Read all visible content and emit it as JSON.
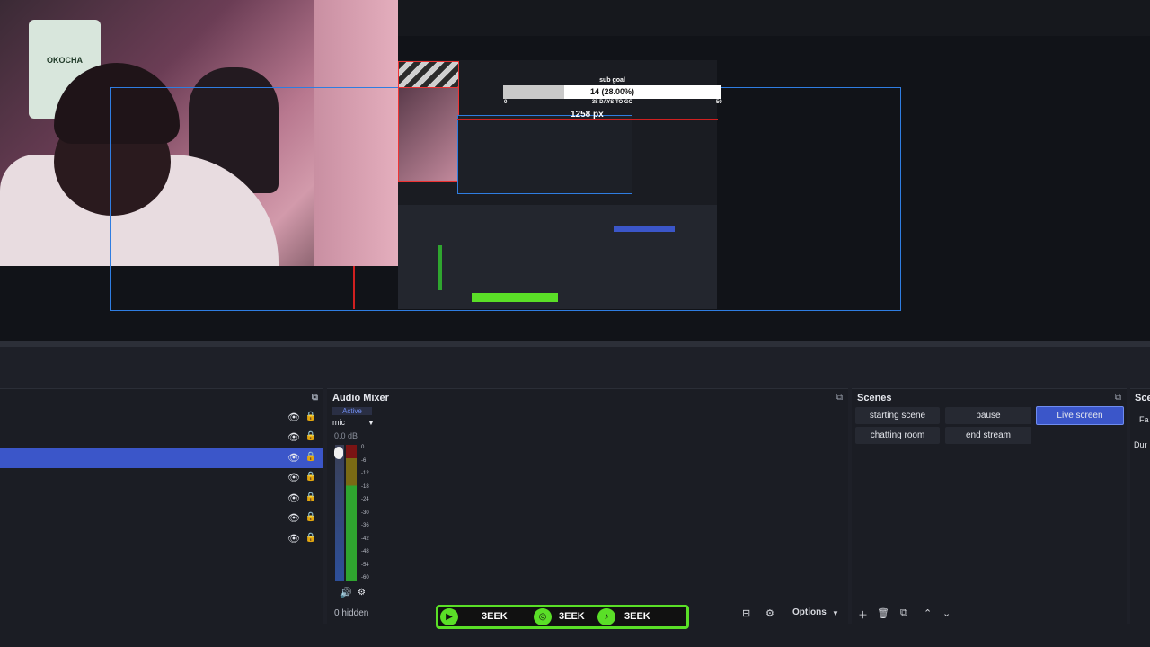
{
  "preview": {
    "sub_goal_title": "sub goal",
    "sub_goal_value": "14 (28.00%)",
    "sub_goal_progress": 0.28,
    "sub_goal_min": "0",
    "sub_goal_max": "50",
    "sub_goal_deadline": "38 DAYS TO GO",
    "measure_label": "1258 px",
    "webcam_jersey_text": "OKOCHA"
  },
  "sources": {
    "float_icon": "popout-icon",
    "rows": [
      {
        "selected": false
      },
      {
        "selected": false
      },
      {
        "selected": true
      },
      {
        "selected": false
      },
      {
        "selected": false
      },
      {
        "selected": false
      },
      {
        "selected": false
      }
    ]
  },
  "mixer": {
    "title": "Audio Mixer",
    "status": "Active",
    "channel": "mic",
    "level": "0.0 dB",
    "ticks": [
      "0",
      "-6",
      "-12",
      "-18",
      "-24",
      "-30",
      "-36",
      "-42",
      "-48",
      "-54",
      "-60"
    ],
    "hidden_label": "0 hidden",
    "options_label": "Options"
  },
  "scenes": {
    "title": "Scenes",
    "items": [
      {
        "label": "starting scene",
        "active": false
      },
      {
        "label": "pause",
        "active": false
      },
      {
        "label": "Live screen",
        "active": true
      },
      {
        "label": "chatting room",
        "active": false
      },
      {
        "label": "end stream",
        "active": false
      }
    ]
  },
  "extra_dock": {
    "title": "Sce",
    "line1": "Fa",
    "line2": "Dur"
  },
  "banner": {
    "items": [
      "3EEK",
      "3EEK",
      "3EEK"
    ]
  },
  "colors": {
    "accent": "#3b56c9",
    "banner_green": "#5adf27",
    "bbox_blue": "#2f7de1",
    "guide_red": "#d02020"
  }
}
